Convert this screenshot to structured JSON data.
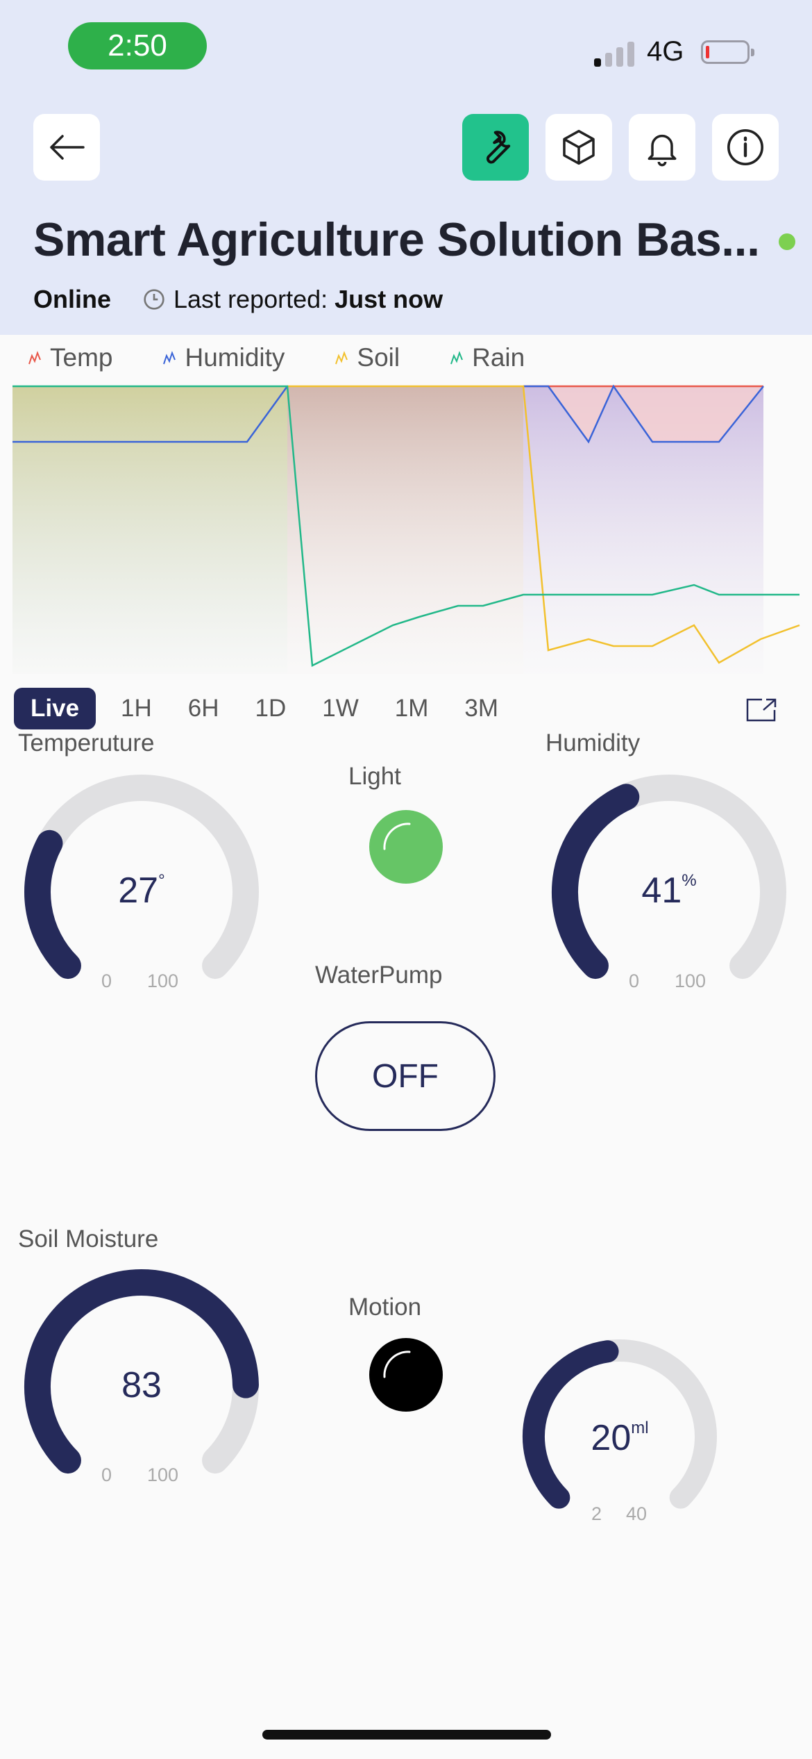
{
  "status_bar": {
    "time": "2:50",
    "network": "4G",
    "signal_bars_active": 1,
    "battery_color": "#e33333"
  },
  "toolbar": {
    "back_icon": "arrow-left-icon",
    "icons": [
      "wrench-icon",
      "cube-icon",
      "bell-icon",
      "info-icon"
    ],
    "active_color": "#22c28c"
  },
  "device": {
    "title": "Smart Agriculture Solution Bas...",
    "status": "Online",
    "last_reported_label": "Last reported:",
    "last_reported_value": "Just now",
    "status_dot_color": "#7dd050"
  },
  "chart_data": {
    "type": "area",
    "series": [
      {
        "name": "Temp",
        "color": "#e8584a"
      },
      {
        "name": "Humidity",
        "color": "#3a64d8"
      },
      {
        "name": "Soil",
        "color": "#f2c12e"
      },
      {
        "name": "Rain",
        "color": "#22b889"
      }
    ]
  },
  "time_ranges": [
    "Live",
    "1H",
    "6H",
    "1D",
    "1W",
    "1M",
    "3M"
  ],
  "widgets": {
    "temperature": {
      "label": "Temperuture",
      "value": "27",
      "unit": "°",
      "min": "0",
      "max": "100",
      "level": 0.27
    },
    "light": {
      "label": "Light",
      "color": "#66c566"
    },
    "humidity": {
      "label": "Humidity",
      "value": "41",
      "unit": "%",
      "min": "0",
      "max": "100",
      "level": 0.41
    },
    "water_pump": {
      "label": "WaterPump",
      "button": "OFF"
    },
    "soil_moisture": {
      "label": "Soil Moisture",
      "value": "83",
      "unit": "",
      "min": "0",
      "max": "100",
      "level": 0.83
    },
    "motion": {
      "label": "Motion",
      "color": "#000000"
    },
    "water": {
      "value": "20",
      "unit": "ml",
      "min": "2",
      "max": "40",
      "level": 0.47
    }
  }
}
